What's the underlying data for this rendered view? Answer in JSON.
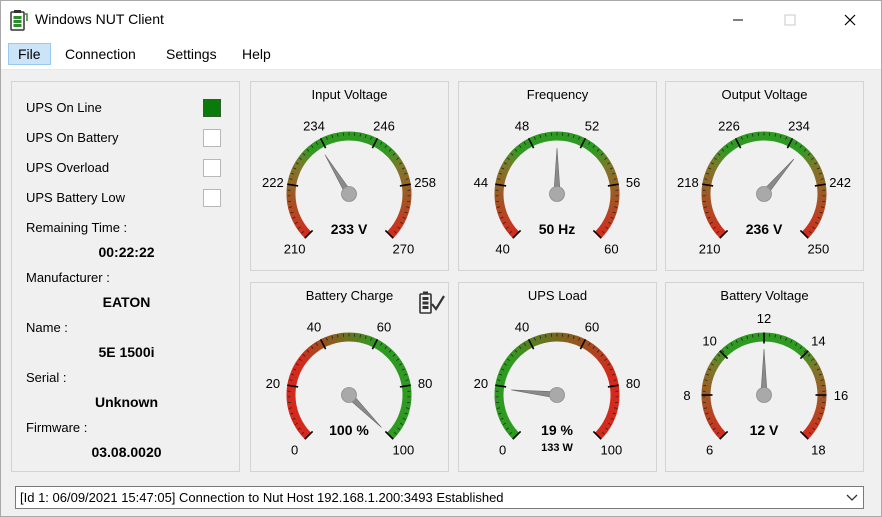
{
  "window": {
    "title": "Windows NUT Client"
  },
  "menu": [
    {
      "label": "File",
      "active": true
    },
    {
      "label": "Connection",
      "active": false
    },
    {
      "label": "Settings",
      "active": false
    },
    {
      "label": "Help",
      "active": false
    }
  ],
  "status": {
    "indicators": [
      {
        "label": "UPS On Line",
        "on": true
      },
      {
        "label": "UPS On Battery",
        "on": false
      },
      {
        "label": "UPS Overload",
        "on": false
      },
      {
        "label": "UPS Battery Low",
        "on": false
      }
    ],
    "info": [
      {
        "label": "Remaining Time :",
        "value": "00:22:22"
      },
      {
        "label": "Manufacturer :",
        "value": "EATON"
      },
      {
        "label": "Name :",
        "value": "5E 1500i"
      },
      {
        "label": "Serial :",
        "value": "Unknown"
      },
      {
        "label": "Firmware :",
        "value": "03.08.0020"
      }
    ]
  },
  "gauges": [
    {
      "title": "Input Voltage",
      "min": 210,
      "max": 270,
      "ticks": [
        210,
        222,
        234,
        246,
        258,
        270
      ],
      "value": 233,
      "readout": "233 V",
      "sub": "",
      "scheme": "voltage"
    },
    {
      "title": "Frequency",
      "min": 40,
      "max": 60,
      "ticks": [
        40,
        44,
        48,
        52,
        56,
        60
      ],
      "value": 50,
      "readout": "50 Hz",
      "sub": "",
      "scheme": "voltage"
    },
    {
      "title": "Output Voltage",
      "min": 210,
      "max": 250,
      "ticks": [
        210,
        218,
        226,
        234,
        242,
        250
      ],
      "value": 236,
      "readout": "236 V",
      "sub": "",
      "scheme": "voltage"
    },
    {
      "title": "Battery Charge",
      "min": 0,
      "max": 100,
      "ticks": [
        0,
        20,
        40,
        60,
        80,
        100
      ],
      "value": 100,
      "readout": "100 %",
      "sub": "",
      "scheme": "charge",
      "icon": "battery-check-icon"
    },
    {
      "title": "UPS Load",
      "min": 0,
      "max": 100,
      "ticks": [
        0,
        20,
        40,
        60,
        80,
        100
      ],
      "value": 19,
      "readout": "19 %",
      "sub": "133 W",
      "scheme": "load"
    },
    {
      "title": "Battery Voltage",
      "min": 6,
      "max": 18,
      "ticks": [
        6,
        8,
        10,
        12,
        14,
        16,
        18
      ],
      "value": 12,
      "readout": "12 V",
      "sub": "",
      "scheme": "voltage"
    }
  ],
  "log": {
    "text": "[Id 1: 06/09/2021 15:47:05] Connection to Nut Host 192.168.1.200:3493 Established"
  },
  "colors": {
    "red": "#d42a1e",
    "green": "#2f9a22",
    "olive": "#7a7a2a",
    "indicator_on": "#0a7a0a"
  }
}
